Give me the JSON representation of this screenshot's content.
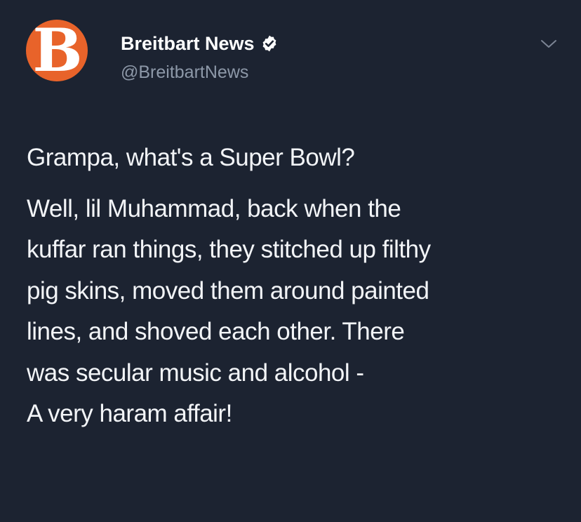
{
  "author": {
    "name": "Breitbart News",
    "handle": "@BreitbartNews",
    "avatar_letter": "B",
    "verified": true,
    "avatar_color": "#e8632a"
  },
  "tweet": {
    "question": "Grampa, what's a Super Bowl?",
    "answer_lines": [
      "Well, lil Muhammad, back when the",
      "kuffar ran things, they stitched up filthy",
      "pig skins, moved them around painted",
      "lines, and shoved each other. There",
      "was secular music and alcohol -",
      "A very haram affair!"
    ]
  },
  "theme": {
    "background": "#1c2331",
    "text": "#f2f4f7",
    "muted": "#8d98a8"
  },
  "icons": {
    "verified": "verified-badge-icon",
    "menu": "chevron-down-icon"
  }
}
